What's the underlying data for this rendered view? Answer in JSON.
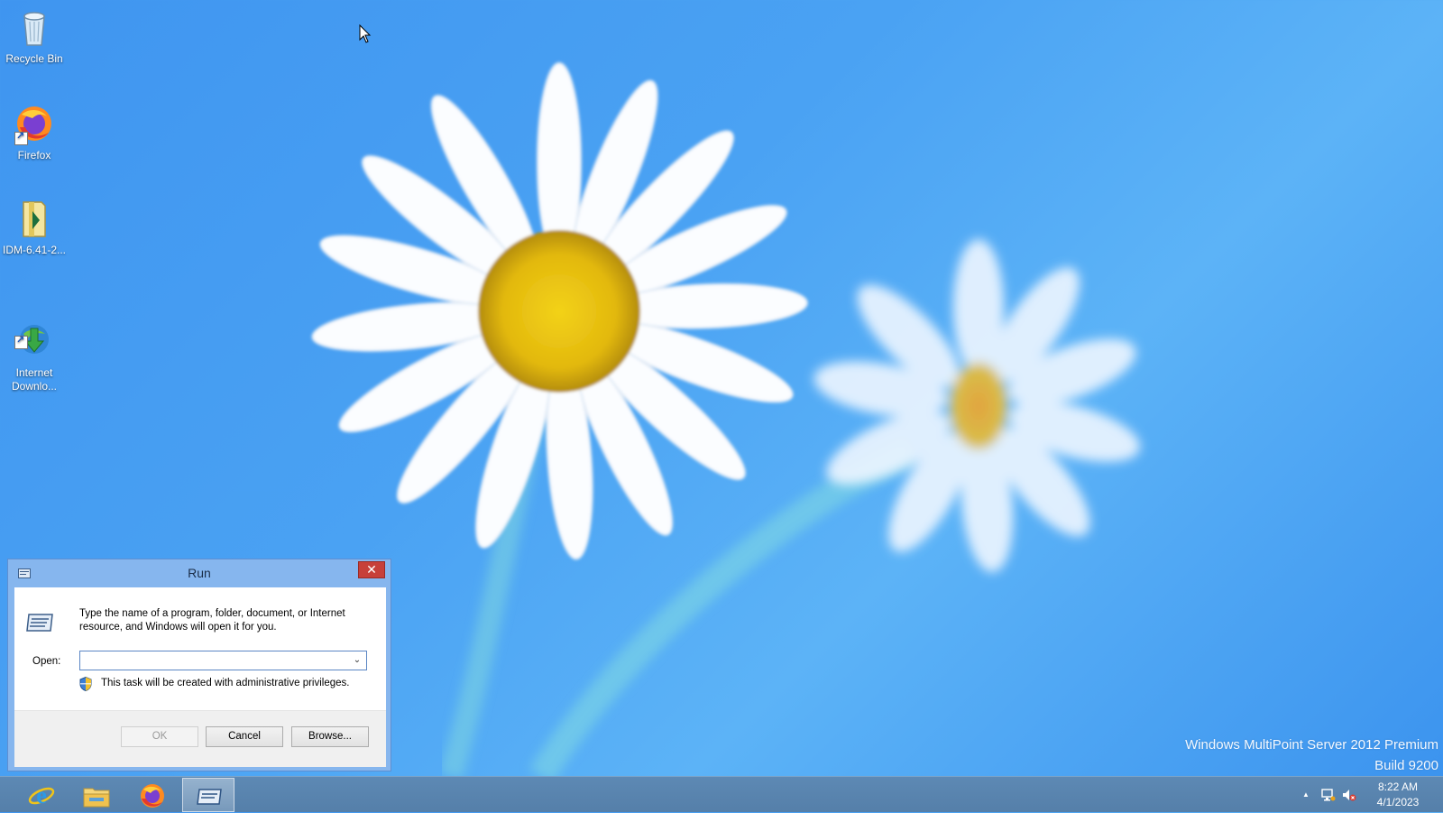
{
  "desktop": {
    "icons": [
      {
        "label": "Recycle Bin",
        "icon": "recycle-bin-icon"
      },
      {
        "label": "Firefox",
        "icon": "firefox-icon"
      },
      {
        "label": "IDM-6.41-2...",
        "icon": "archive-folder-icon"
      },
      {
        "label": "Internet\nDownlo...",
        "icon": "internet-download-manager-icon"
      }
    ],
    "watermark": {
      "line1": "Windows MultiPoint Server 2012 Premium",
      "line2": "Build 9200"
    }
  },
  "run_dialog": {
    "title": "Run",
    "close_glyph": "✕",
    "description": "Type the name of a program, folder, document, or Internet resource, and Windows will open it for you.",
    "open_label": "Open:",
    "open_value": "",
    "admin_note": "This task will be created with administrative privileges.",
    "buttons": {
      "ok": "OK",
      "cancel": "Cancel",
      "browse": "Browse..."
    }
  },
  "taskbar": {
    "pinned": [
      "internet-explorer-icon",
      "file-explorer-icon",
      "firefox-icon",
      "run-icon"
    ],
    "active": "run-icon",
    "tray": {
      "show_hidden_glyph": "▲",
      "time": "8:22 AM",
      "date": "4/1/2023"
    }
  },
  "colors": {
    "desktop_blue": "#4aa2f3",
    "taskbar": "#5d89b4",
    "dialog_frame": "#86b6ee",
    "close_button": "#c7403a"
  }
}
